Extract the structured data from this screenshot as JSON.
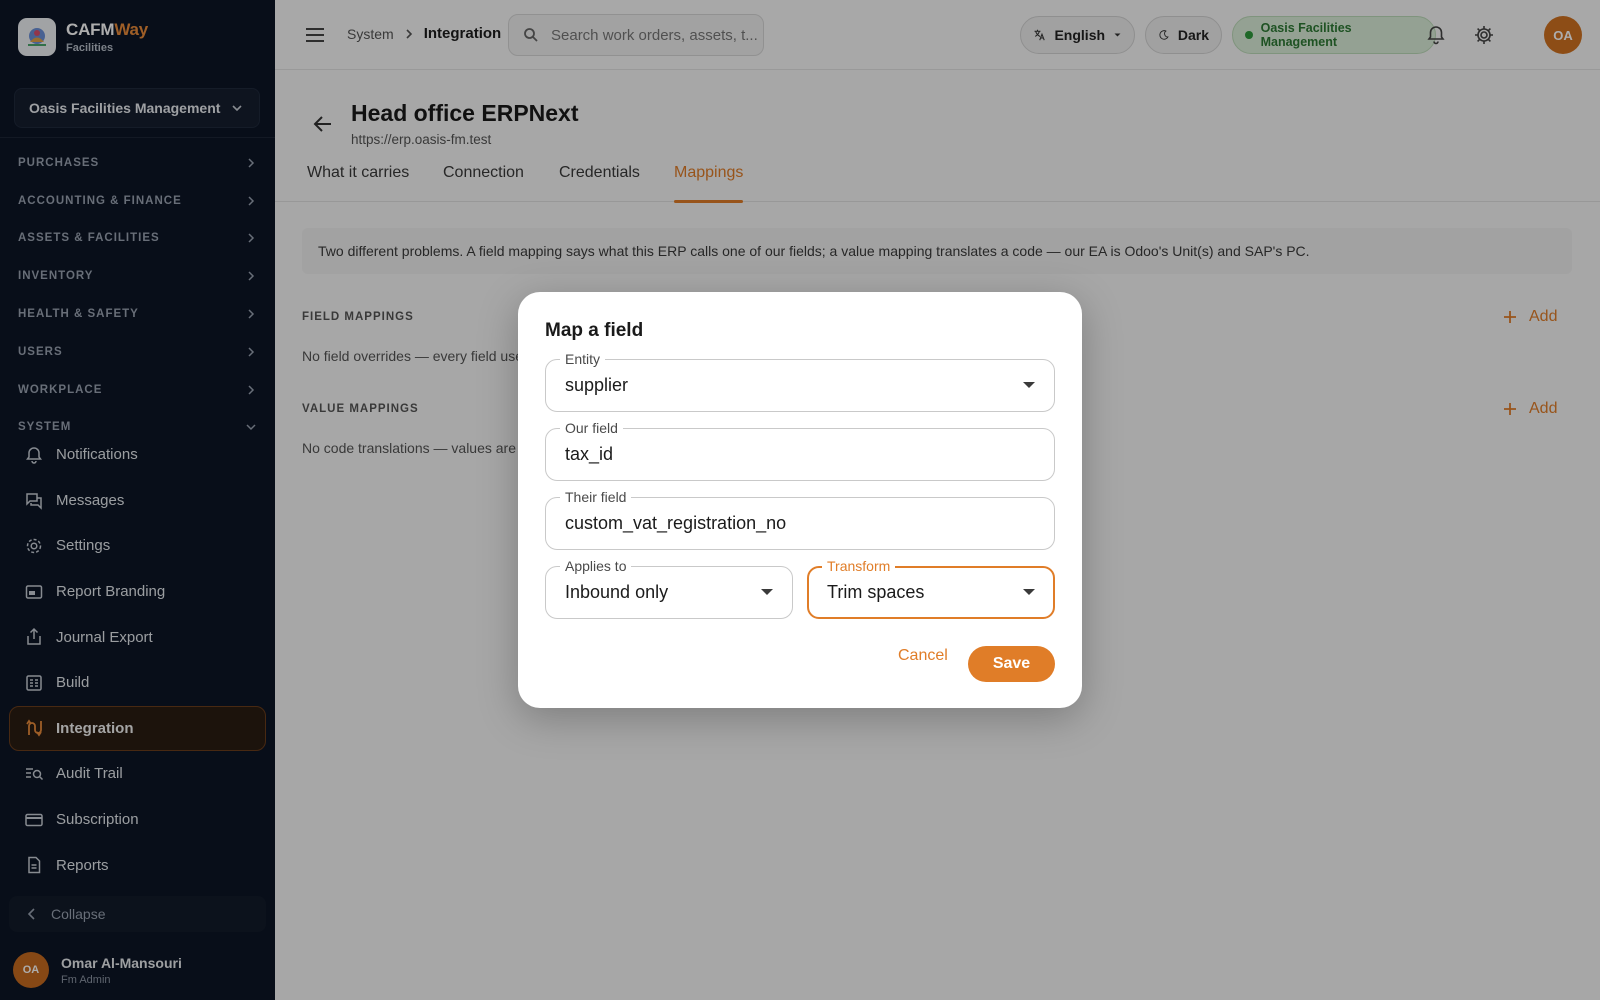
{
  "sidebar": {
    "brand_name_a": "CAFM",
    "brand_name_b": "Way",
    "brand_sub": "Facilities",
    "org_select": "Oasis Facilities Management",
    "groups": [
      {
        "label": "PURCHASES"
      },
      {
        "label": "ACCOUNTING & FINANCE"
      },
      {
        "label": "ASSETS & FACILITIES"
      },
      {
        "label": "INVENTORY"
      },
      {
        "label": "HEALTH & SAFETY"
      },
      {
        "label": "USERS"
      },
      {
        "label": "WORKPLACE"
      },
      {
        "label": "SYSTEM"
      }
    ],
    "items": [
      {
        "label": "Notifications",
        "icon": "bell-icon"
      },
      {
        "label": "Messages",
        "icon": "chat-icon"
      },
      {
        "label": "Settings",
        "icon": "gear-icon"
      },
      {
        "label": "Report Branding",
        "icon": "branding-icon"
      },
      {
        "label": "Journal Export",
        "icon": "export-icon"
      },
      {
        "label": "Build",
        "icon": "build-icon"
      },
      {
        "label": "Integration",
        "icon": "integration-icon",
        "active": true
      },
      {
        "label": "Audit Trail",
        "icon": "audit-icon"
      },
      {
        "label": "Subscription",
        "icon": "card-icon"
      },
      {
        "label": "Reports",
        "icon": "report-icon"
      }
    ],
    "collapse_label": "Collapse",
    "user": {
      "initials": "OA",
      "name": "Omar Al-Mansouri",
      "role": "Fm Admin"
    }
  },
  "topbar": {
    "breadcrumb_parent": "System",
    "breadcrumb_current": "Integration",
    "search_placeholder": "Search work orders, assets, t...",
    "language": "English",
    "theme": "Dark",
    "org_badge": "Oasis Facilities Management",
    "avatar_initials": "OA"
  },
  "page": {
    "title": "Head office ERPNext",
    "url": "https://erp.oasis-fm.test",
    "tabs": [
      {
        "label": "What it carries"
      },
      {
        "label": "Connection"
      },
      {
        "label": "Credentials"
      },
      {
        "label": "Mappings",
        "active": true
      }
    ],
    "info": "Two different problems. A field mapping says what this ERP calls one of our fields; a value mapping translates a code — our EA is Odoo's Unit(s) and SAP's PC.",
    "field_mappings": {
      "heading": "FIELD MAPPINGS",
      "empty": "No field overrides — every field uses",
      "add_label": "Add"
    },
    "value_mappings": {
      "heading": "VALUE MAPPINGS",
      "empty": "No code translations — values are p",
      "add_label": "Add"
    }
  },
  "dialog": {
    "title": "Map a field",
    "entity": {
      "label": "Entity",
      "value": "supplier"
    },
    "our_field": {
      "label": "Our field",
      "value": "tax_id"
    },
    "their_field": {
      "label": "Their field",
      "value": "custom_vat_registration_no"
    },
    "applies_to": {
      "label": "Applies to",
      "value": "Inbound only"
    },
    "transform": {
      "label": "Transform",
      "value": "Trim spaces"
    },
    "cancel_label": "Cancel",
    "save_label": "Save"
  },
  "colors": {
    "accent": "#e07d28",
    "sidebar_bg": "#0c1525",
    "org_badge_green": "#2d7a34"
  }
}
